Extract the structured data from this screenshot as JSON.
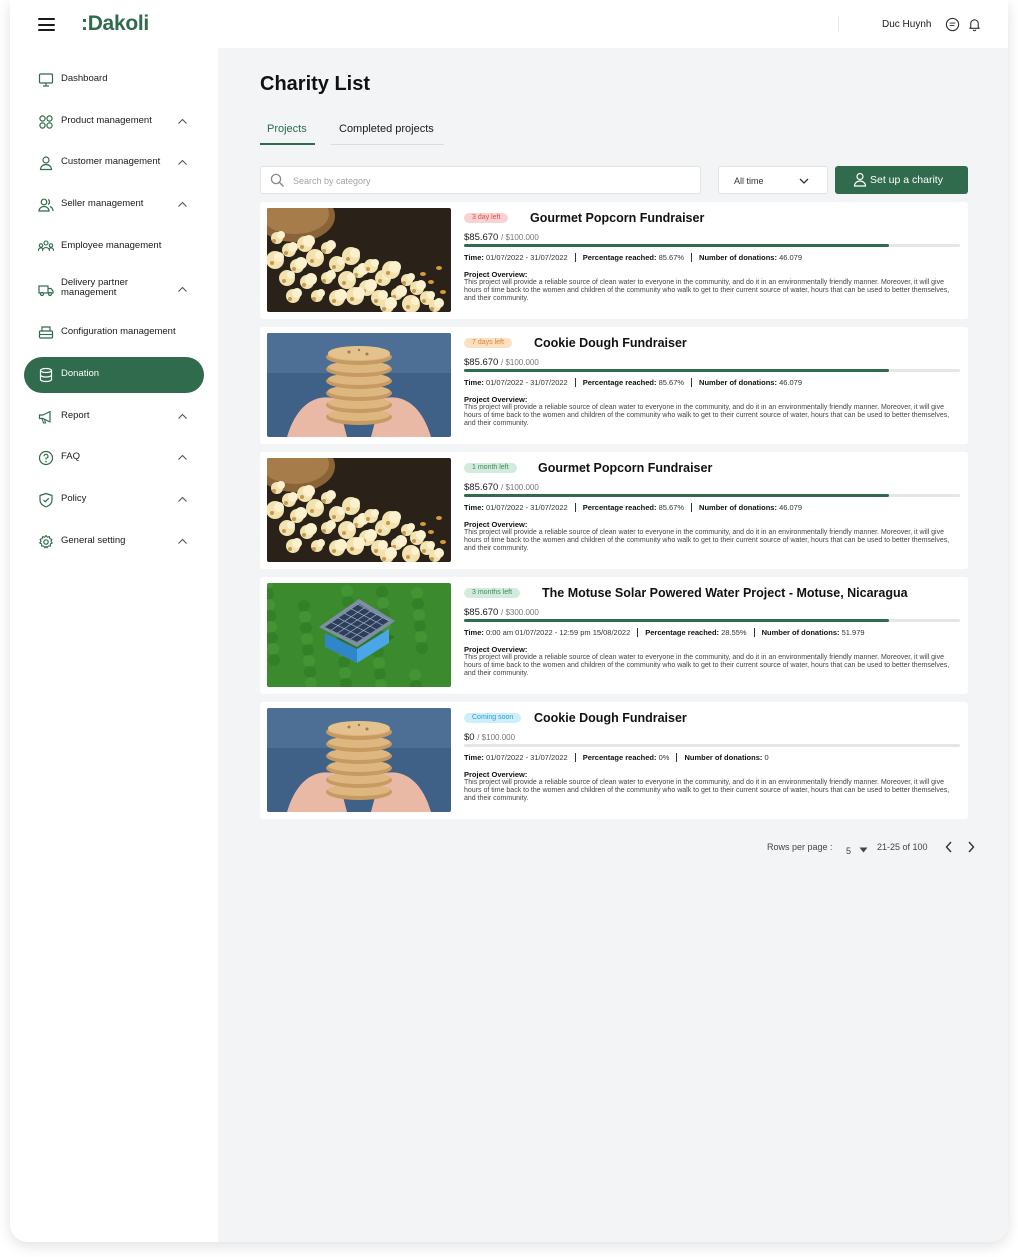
{
  "app": {
    "logo": ":Dakoli",
    "username": "Duc Huynh",
    "icons": [
      "menu-icon",
      "message-icon",
      "bell-icon"
    ]
  },
  "sidebar": {
    "items": [
      {
        "label": "Dashboard",
        "icon": "monitor-icon",
        "expandable": false,
        "active": false
      },
      {
        "label": "Product management",
        "icon": "grid-icon",
        "expandable": true,
        "active": false
      },
      {
        "label": "Customer management",
        "icon": "user-icon",
        "expandable": true,
        "active": false
      },
      {
        "label": "Seller management",
        "icon": "users-icon",
        "expandable": true,
        "active": false
      },
      {
        "label": "Employee management",
        "icon": "team-icon",
        "expandable": false,
        "active": false
      },
      {
        "label": "Delivery partner management",
        "icon": "truck-icon",
        "expandable": true,
        "active": false
      },
      {
        "label": "Configuration management",
        "icon": "printer-icon",
        "expandable": false,
        "active": false
      },
      {
        "label": "Donation",
        "icon": "database-icon",
        "expandable": false,
        "active": true
      },
      {
        "label": "Report",
        "icon": "megaphone-icon",
        "expandable": true,
        "active": false
      },
      {
        "label": "FAQ",
        "icon": "help-circle-icon",
        "expandable": true,
        "active": false
      },
      {
        "label": "Policy",
        "icon": "shield-icon",
        "expandable": true,
        "active": false
      },
      {
        "label": "General setting",
        "icon": "settings-icon",
        "expandable": true,
        "active": false
      }
    ]
  },
  "main": {
    "title": "Charity List",
    "tabs": [
      {
        "label": "Projects",
        "active": true
      },
      {
        "label": "Completed projects",
        "active": false
      }
    ],
    "search": {
      "placeholder": "Search by category",
      "value": ""
    },
    "time_filter": "All time",
    "setup_button": "Set up a charity"
  },
  "projects": [
    {
      "badge": "3 day left",
      "badge_color": "#f9d3d3",
      "badge_text_color": "#d9534f",
      "title": "Gourmet Popcorn Fundraiser",
      "raised": "$85.670",
      "goal": "$100.000",
      "progress": 0.8567,
      "time": "01/07/2022 - 31/07/2022",
      "percentage": "85.67%",
      "donations": "46.079",
      "overview_label": "Project Overview:",
      "overview": "This project will provide a reliable source of clean water to everyone in the community, and do it in an environmentally friendly manner. Moreover, it will give hours of time back to the women and children of the community who walk to get to their current source of water, hours that can be used to better themselves, and their community.",
      "image": "popcorn"
    },
    {
      "badge": "7 days left",
      "badge_color": "#fde0c2",
      "badge_text_color": "#d9822b",
      "title": "Cookie Dough Fundraiser",
      "raised": "$85.670",
      "goal": "$100.000",
      "progress": 0.8567,
      "time": "01/07/2022 - 31/07/2022",
      "percentage": "85.67%",
      "donations": "46.079",
      "overview_label": "Project Overview:",
      "overview": "This project will provide a reliable source of clean water to everyone in the community, and do it in an environmentally friendly manner. Moreover, it will give hours of time back to the women and children of the community who walk to get to their current source of water, hours that can be used to better themselves, and their community.",
      "image": "cookies"
    },
    {
      "badge": "1 month left",
      "badge_color": "#d3ebdc",
      "badge_text_color": "#3d8a5c",
      "title": "Gourmet Popcorn Fundraiser",
      "raised": "$85.670",
      "goal": "$100.000",
      "progress": 0.8567,
      "time": "01/07/2022 - 31/07/2022",
      "percentage": "85.67%",
      "donations": "46.079",
      "overview_label": "Project Overview:",
      "overview": "This project will provide a reliable source of clean water to everyone in the community, and do it in an environmentally friendly manner. Moreover, it will give hours of time back to the women and children of the community who walk to get to their current source of water, hours that can be used to better themselves, and their community.",
      "image": "popcorn"
    },
    {
      "badge": "3 months left",
      "badge_color": "#d3ebdc",
      "badge_text_color": "#3d8a5c",
      "title": "The Motuse Solar Powered Water Project - Motuse, Nicaragua",
      "raised": "$85.670",
      "goal": "$300.000",
      "progress": 0.8567,
      "time": "0:00 am 01/07/2022 - 12:59 pm 15/08/2022",
      "percentage": "28.55%",
      "donations": "51.979",
      "overview_label": "Project Overview:",
      "overview": "This project will provide a reliable source of clean water to everyone in the community, and do it in an environmentally friendly manner. Moreover, it will give hours of time back to the women and children of the community who walk to get to their current source of water, hours that can be used to better themselves, and their community.",
      "image": "solar"
    },
    {
      "badge": "Coming soon",
      "badge_color": "#cdeefb",
      "badge_text_color": "#2a9fd0",
      "title": "Cookie Dough Fundraiser",
      "raised": "$0",
      "goal": "$100.000",
      "progress": 0,
      "time": "01/07/2022 - 31/07/2022",
      "percentage": "0%",
      "donations": "0",
      "overview_label": "Project Overview:",
      "overview": "This project will provide a reliable source of clean water to everyone in the community, and do it in an environmentally friendly manner. Moreover, it will give hours of time back to the women and children of the community who walk to get to their current source of water, hours that can be used to better themselves, and their community.",
      "image": "cookies"
    }
  ],
  "labels": {
    "time": "Time:",
    "percentage": "Percentage reached:",
    "donations": "Number of donations:"
  },
  "pagination": {
    "rows_label": "Rows per page :",
    "rows_value": "5",
    "range": "21-25 of 100"
  },
  "colors": {
    "brand": "#2f6b4c",
    "background": "#f3f4f6"
  }
}
